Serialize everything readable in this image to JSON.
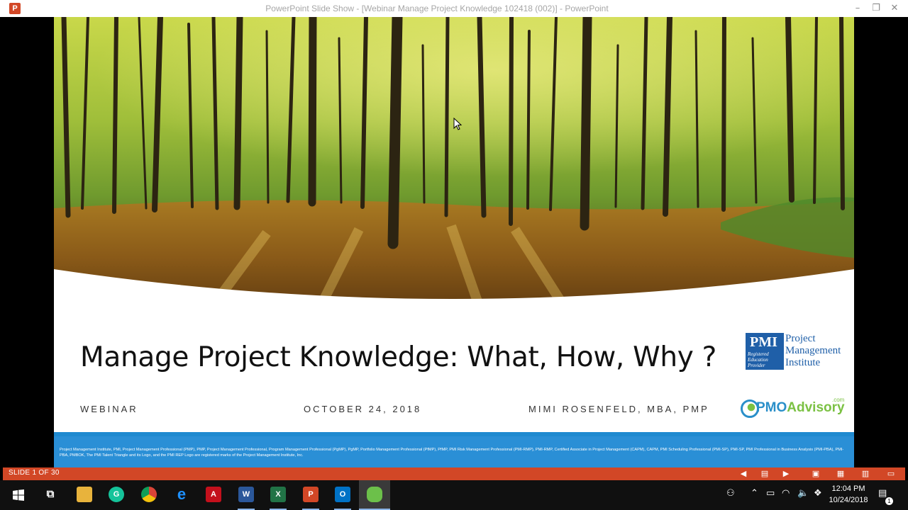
{
  "window": {
    "title": "PowerPoint Slide Show - [Webinar Manage Project Knowledge 102418 (002)] - PowerPoint",
    "app_icon": "powerpoint-icon"
  },
  "slide": {
    "title": "Manage Project Knowledge: What, How, Why ?",
    "label_left": "WEBINAR",
    "date": "OCTOBER 24, 2018",
    "presenter": "MIMI ROSENFELD, MBA, PMP",
    "pmi_logo": {
      "name": "Project\nManagement\nInstitute",
      "badge": "Registered\nEducation\nProvider",
      "mark": "PMI"
    },
    "pmo_logo": {
      "main": "PMO",
      "accent": "Advisory",
      "suffix": ".com"
    },
    "footer_text": "Project Management Institute, PMI, Project Management Professional (PMP), PMP, Project Management Professional, Program Management Professional (PgMP), PgMP, Portfolio Management Professional (PfMP), PfMP, PMI Risk Management Professional (PMI-RMP), PMI-RMP, Certified Associate in Project Management (CAPM), CAPM, PMI Scheduling Professional (PMI-SP), PMI-SP, PMI Professional in Business Analysis (PMI-PBA), PMI-PBA, PMBOK, The PMI Talent Triangle and its Logo, and the PMI REP Logo are registered marks of the Project Management Institute, Inc."
  },
  "statusbar": {
    "slide_indicator": "SLIDE 1 OF 30"
  },
  "taskbar": {
    "apps": [
      "start-icon",
      "task-view-icon",
      "file-explorer-icon",
      "grammarly-icon",
      "chrome-icon",
      "edge-icon",
      "acrobat-icon",
      "word-icon",
      "excel-icon",
      "powerpoint-icon",
      "outlook-icon",
      "meeting-app-icon"
    ],
    "time": "12:04 PM",
    "date": "10/24/2018",
    "notification_count": "1"
  },
  "colors": {
    "accent": "#d24726",
    "footer": "#2a8fd6",
    "pmi_blue": "#1f5fa8"
  }
}
